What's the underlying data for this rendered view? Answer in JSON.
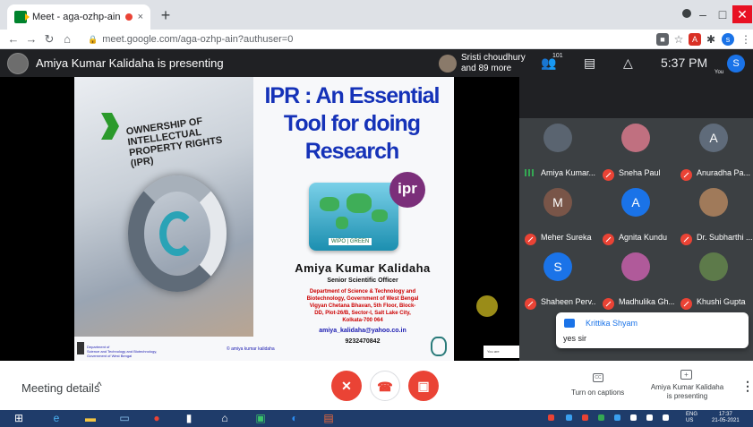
{
  "browser": {
    "tab_title": "Meet - aga-ozhp-ain",
    "tab_close": "×",
    "new_tab": "+",
    "url": "meet.google.com/aga-ozhp-ain?authuser=0",
    "minimize": "–",
    "maximize": "□",
    "close": "✕",
    "profile_initial": "s"
  },
  "meet": {
    "presenting_banner": "Amiya Kumar Kalidaha is presenting",
    "people_summary": [
      "Sristi choudhury",
      "and 89 more"
    ],
    "participant_count": "101",
    "time": "5:37 PM",
    "you_initial": "S",
    "you_label": "You"
  },
  "slide": {
    "title_lines": [
      "IPR : An Essential",
      "Tool for doing",
      "Research"
    ],
    "ownership_lines": [
      "OWNERSHIP OF",
      "INTELLECTUAL",
      "PROPERTY RIGHTS",
      "(IPR)"
    ],
    "badge": "ipr",
    "wipo": "WIPO | GREEN",
    "author_name": "Amiya Kumar Kalidaha",
    "author_role": "Senior Scientific Officer",
    "author_dept": [
      "Department of Science & Technology and",
      "Biotechnology, Government of West Bengal",
      "Vigyan Chetana Bhavan, 5th Floor, Block-",
      "DD, Plot-26/B, Sector-I, Salt Lake City,",
      "Kolkata-700 064"
    ],
    "email": "amiya_kalidaha@yahoo.co.in",
    "phone": "9232470842",
    "footer_dept": [
      "Department of",
      "Science and Technology and Biotechnology,",
      "Government of West Bengal"
    ],
    "footer_copy": "© amiya kumar kalidaha"
  },
  "participants": [
    {
      "name": "Amiya Kumar...",
      "initial": "",
      "color": "#5a6470",
      "status": "speaking"
    },
    {
      "name": "Sneha Paul",
      "initial": "",
      "color": "#c07080",
      "status": "muted"
    },
    {
      "name": "Anuradha Pa...",
      "initial": "A",
      "color": "#5f6b7a",
      "status": "muted"
    },
    {
      "name": "Meher Sureka",
      "initial": "M",
      "color": "#795548",
      "status": "muted"
    },
    {
      "name": "Agnita Kundu",
      "initial": "A",
      "color": "#1a73e8",
      "status": "muted"
    },
    {
      "name": "Dr. Subharthi ...",
      "initial": "",
      "color": "#a07a5a",
      "status": "muted"
    },
    {
      "name": "Shaheen Perv...",
      "initial": "S",
      "color": "#1a73e8",
      "status": "muted"
    },
    {
      "name": "Madhulika Gh...",
      "initial": "",
      "color": "#b05a9a",
      "status": "muted"
    },
    {
      "name": "Khushi Gupta",
      "initial": "",
      "color": "#5d7a4a",
      "status": "muted"
    }
  ],
  "chat_popup": {
    "name": "Krittika Shyam",
    "message": "yes sir"
  },
  "mini_overlay": "You are",
  "bottom": {
    "meeting_details": "Meeting details",
    "chevron": "^",
    "captions_label": "Turn on captions",
    "presenting_label": "Amiya Kumar Kalidaha is presenting",
    "more": "⋮"
  },
  "taskbar": {
    "lang": [
      "ENG",
      "US"
    ],
    "time": [
      "17:37",
      "21-05-2021"
    ]
  },
  "colors": {
    "accent": "#1a73e8",
    "danger": "#ea4335",
    "meet_bg": "#202124"
  }
}
